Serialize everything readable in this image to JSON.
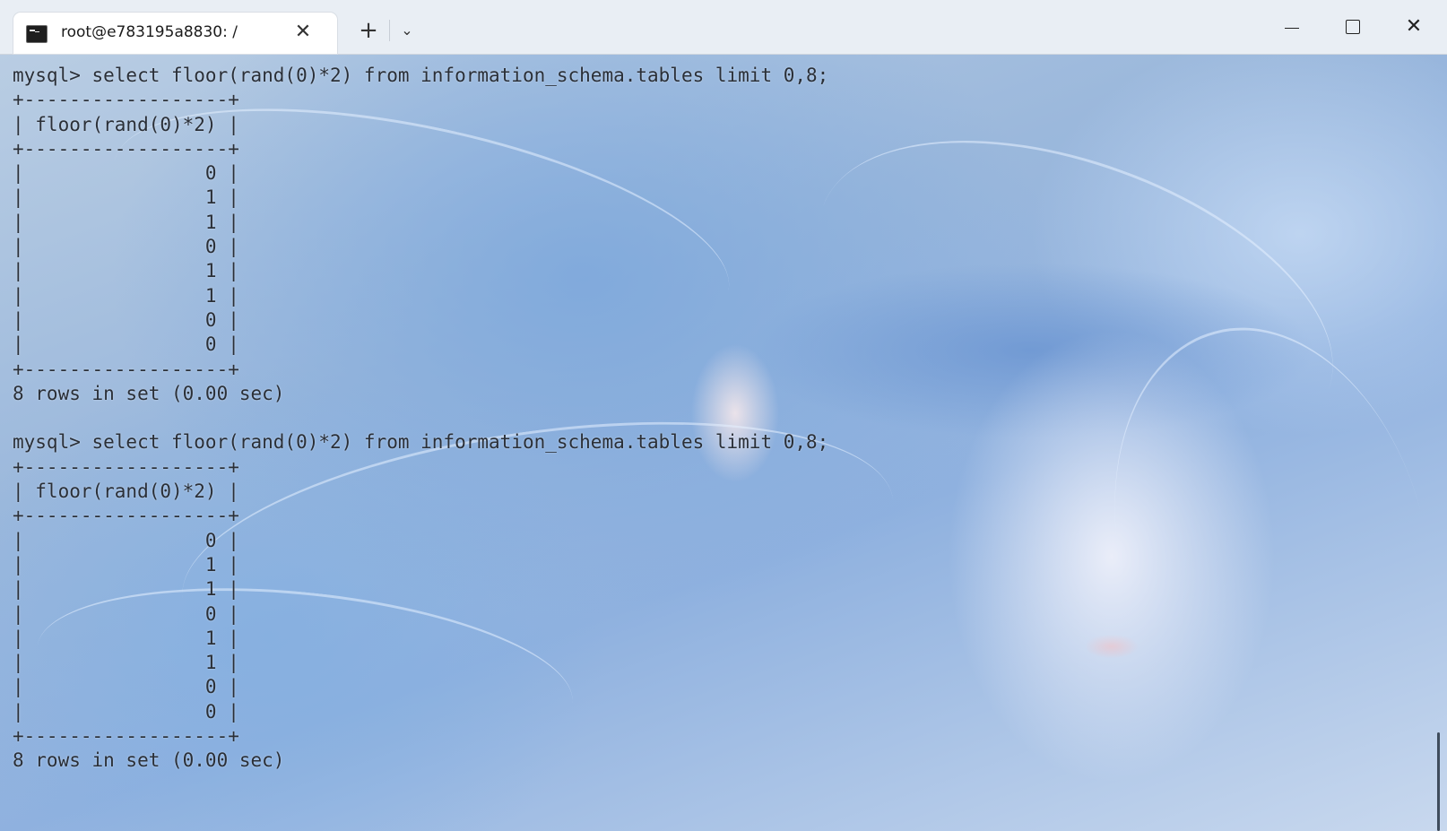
{
  "window": {
    "tab_title": "root@e783195a8830: /",
    "new_tab_symbol": "+",
    "dropdown_symbol": "⌄",
    "close_tab_symbol": "✕",
    "close_window_symbol": "✕"
  },
  "terminal": {
    "lines": [
      "mysql> select floor(rand(0)*2) from information_schema.tables limit 0,8;",
      "+------------------+",
      "| floor(rand(0)*2) |",
      "+------------------+",
      "|                0 |",
      "|                1 |",
      "|                1 |",
      "|                0 |",
      "|                1 |",
      "|                1 |",
      "|                0 |",
      "|                0 |",
      "+------------------+",
      "8 rows in set (0.00 sec)",
      "",
      "mysql> select floor(rand(0)*2) from information_schema.tables limit 0,8;",
      "+------------------+",
      "| floor(rand(0)*2) |",
      "+------------------+",
      "|                0 |",
      "|                1 |",
      "|                1 |",
      "|                0 |",
      "|                1 |",
      "|                1 |",
      "|                0 |",
      "|                0 |",
      "+------------------+",
      "8 rows in set (0.00 sec)"
    ]
  }
}
